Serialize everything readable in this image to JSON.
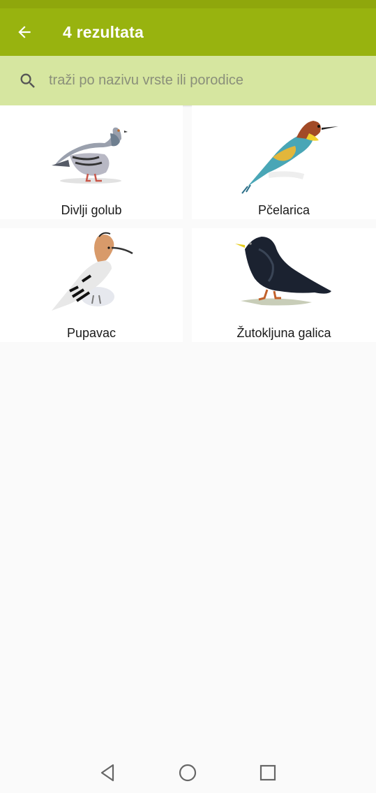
{
  "header": {
    "title": "4 rezultata",
    "back_icon": "arrow-back-icon"
  },
  "search": {
    "placeholder": "traži po nazivu vrste ili porodice",
    "value": "",
    "icon": "search-icon"
  },
  "results": [
    {
      "name": "Divlji golub"
    },
    {
      "name": "Pčelarica"
    },
    {
      "name": "Pupavac"
    },
    {
      "name": "Žutokljuna galica"
    }
  ],
  "navigation": {
    "back": "nav-back-icon",
    "home": "nav-home-icon",
    "recents": "nav-recents-icon"
  },
  "colors": {
    "appbar": "#98b30f",
    "searchbar": "#d6e6a0",
    "background": "#fafafa"
  }
}
